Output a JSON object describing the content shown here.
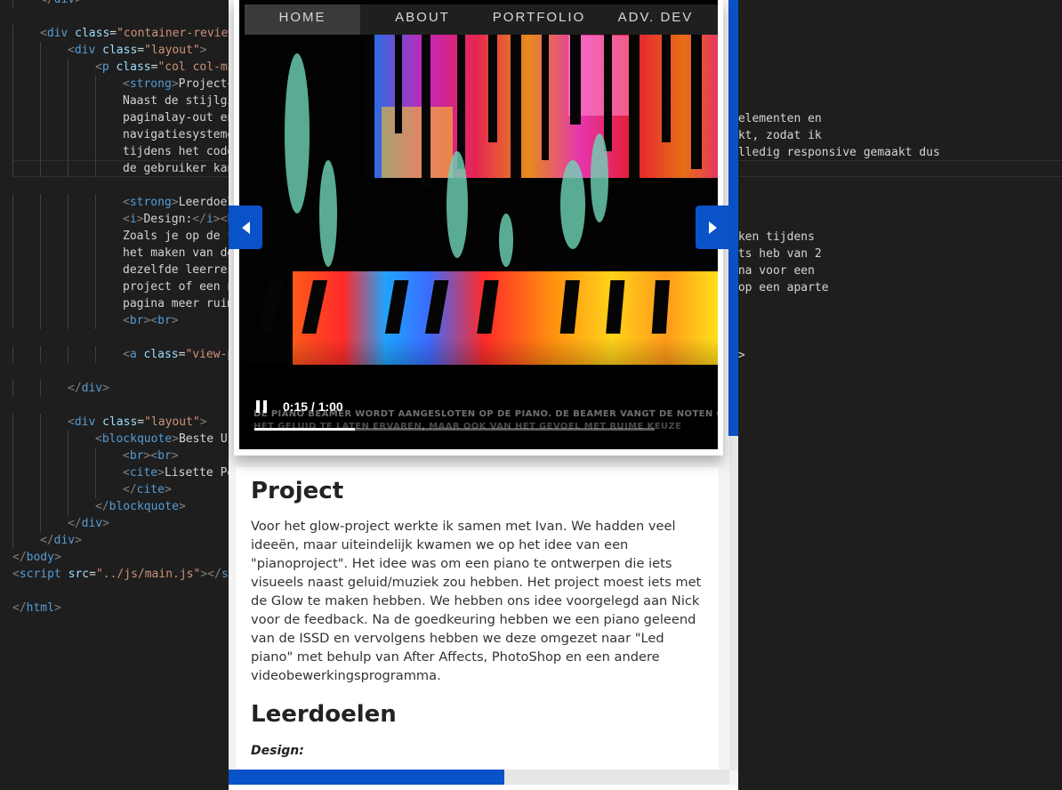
{
  "editor": {
    "lines": [
      {
        "indent": 1,
        "html": [
          {
            "t": "br",
            "v": "</"
          },
          {
            "t": "tag",
            "v": "div"
          },
          {
            "t": "br",
            "v": ">"
          }
        ]
      },
      {
        "indent": 0,
        "html": []
      },
      {
        "indent": 1,
        "html": [
          {
            "t": "br",
            "v": "<"
          },
          {
            "t": "tag",
            "v": "div"
          },
          {
            "t": "txt",
            "v": " "
          },
          {
            "t": "attr",
            "v": "class"
          },
          {
            "t": "txt",
            "v": "="
          },
          {
            "t": "str",
            "v": "\"container-review"
          }
        ]
      },
      {
        "indent": 2,
        "html": [
          {
            "t": "br",
            "v": "<"
          },
          {
            "t": "tag",
            "v": "div"
          },
          {
            "t": "txt",
            "v": " "
          },
          {
            "t": "attr",
            "v": "class"
          },
          {
            "t": "txt",
            "v": "="
          },
          {
            "t": "str",
            "v": "\"layout\""
          },
          {
            "t": "br",
            "v": ">"
          }
        ]
      },
      {
        "indent": 3,
        "html": [
          {
            "t": "br",
            "v": "<"
          },
          {
            "t": "tag",
            "v": "p"
          },
          {
            "t": "txt",
            "v": " "
          },
          {
            "t": "attr",
            "v": "class"
          },
          {
            "t": "txt",
            "v": "="
          },
          {
            "t": "str",
            "v": "\"col col-ma"
          }
        ]
      },
      {
        "indent": 4,
        "html": [
          {
            "t": "br",
            "v": "<"
          },
          {
            "t": "tag",
            "v": "strong"
          },
          {
            "t": "br",
            "v": ">"
          },
          {
            "t": "txt",
            "v": "Project"
          },
          {
            "t": "br",
            "v": "<"
          }
        ]
      },
      {
        "indent": 4,
        "html": [
          {
            "t": "txt",
            "v": "Naast de stijlgi"
          }
        ]
      },
      {
        "indent": 4,
        "html": [
          {
            "t": "txt",
            "v": "paginalay-out en"
          }
        ]
      },
      {
        "indent": 4,
        "html": [
          {
            "t": "txt",
            "v": "navigatiesysteme"
          }
        ]
      },
      {
        "indent": 4,
        "html": [
          {
            "t": "txt",
            "v": "tijdens het code"
          }
        ]
      },
      {
        "indent": 4,
        "html": [
          {
            "t": "txt",
            "v": "de gebruiker kan"
          }
        ],
        "hl": true
      },
      {
        "indent": 0,
        "html": []
      },
      {
        "indent": 4,
        "html": [
          {
            "t": "br",
            "v": "<"
          },
          {
            "t": "tag",
            "v": "strong"
          },
          {
            "t": "br",
            "v": ">"
          },
          {
            "t": "txt",
            "v": "Leerdoel"
          }
        ]
      },
      {
        "indent": 4,
        "html": [
          {
            "t": "br",
            "v": "<"
          },
          {
            "t": "tag",
            "v": "i"
          },
          {
            "t": "br",
            "v": ">"
          },
          {
            "t": "txt",
            "v": "Design:"
          },
          {
            "t": "br",
            "v": "</"
          },
          {
            "t": "tag",
            "v": "i"
          },
          {
            "t": "br",
            "v": "><"
          },
          {
            "t": "tag",
            "v": "b"
          }
        ]
      },
      {
        "indent": 4,
        "html": [
          {
            "t": "txt",
            "v": "Zoals je op de f"
          }
        ]
      },
      {
        "indent": 4,
        "html": [
          {
            "t": "txt",
            "v": "het maken van de"
          }
        ]
      },
      {
        "indent": 4,
        "html": [
          {
            "t": "txt",
            "v": "dezelfde leerres"
          }
        ]
      },
      {
        "indent": 4,
        "html": [
          {
            "t": "txt",
            "v": "project of een n"
          }
        ]
      },
      {
        "indent": 4,
        "html": [
          {
            "t": "txt",
            "v": "pagina meer ruim"
          }
        ]
      },
      {
        "indent": 4,
        "html": [
          {
            "t": "br",
            "v": "<"
          },
          {
            "t": "tag",
            "v": "br"
          },
          {
            "t": "br",
            "v": "><"
          },
          {
            "t": "tag",
            "v": "br"
          },
          {
            "t": "br",
            "v": ">"
          }
        ]
      },
      {
        "indent": 0,
        "html": []
      },
      {
        "indent": 4,
        "html": [
          {
            "t": "br",
            "v": "<"
          },
          {
            "t": "tag",
            "v": "a"
          },
          {
            "t": "txt",
            "v": " "
          },
          {
            "t": "attr",
            "v": "class"
          },
          {
            "t": "txt",
            "v": "="
          },
          {
            "t": "str",
            "v": "\"view-p"
          }
        ]
      },
      {
        "indent": 0,
        "html": []
      },
      {
        "indent": 2,
        "html": [
          {
            "t": "br",
            "v": "</"
          },
          {
            "t": "tag",
            "v": "div"
          },
          {
            "t": "br",
            "v": ">"
          }
        ]
      },
      {
        "indent": 0,
        "html": []
      },
      {
        "indent": 2,
        "html": [
          {
            "t": "br",
            "v": "<"
          },
          {
            "t": "tag",
            "v": "div"
          },
          {
            "t": "txt",
            "v": " "
          },
          {
            "t": "attr",
            "v": "class"
          },
          {
            "t": "txt",
            "v": "="
          },
          {
            "t": "str",
            "v": "\"layout\""
          },
          {
            "t": "br",
            "v": ">"
          }
        ]
      },
      {
        "indent": 3,
        "html": [
          {
            "t": "br",
            "v": "<"
          },
          {
            "t": "tag",
            "v": "blockquote"
          },
          {
            "t": "br",
            "v": ">"
          },
          {
            "t": "txt",
            "v": "Beste Ur"
          }
        ]
      },
      {
        "indent": 4,
        "html": [
          {
            "t": "br",
            "v": "<"
          },
          {
            "t": "tag",
            "v": "br"
          },
          {
            "t": "br",
            "v": "><"
          },
          {
            "t": "tag",
            "v": "br"
          },
          {
            "t": "br",
            "v": ">"
          }
        ]
      },
      {
        "indent": 4,
        "html": [
          {
            "t": "br",
            "v": "<"
          },
          {
            "t": "tag",
            "v": "cite"
          },
          {
            "t": "br",
            "v": ">"
          },
          {
            "t": "txt",
            "v": "Lisette Pe"
          }
        ]
      },
      {
        "indent": 4,
        "html": [
          {
            "t": "br",
            "v": "</"
          },
          {
            "t": "tag",
            "v": "cite"
          },
          {
            "t": "br",
            "v": ">"
          }
        ]
      },
      {
        "indent": 3,
        "html": [
          {
            "t": "br",
            "v": "</"
          },
          {
            "t": "tag",
            "v": "blockquote"
          },
          {
            "t": "br",
            "v": ">"
          }
        ]
      },
      {
        "indent": 2,
        "html": [
          {
            "t": "br",
            "v": "</"
          },
          {
            "t": "tag",
            "v": "div"
          },
          {
            "t": "br",
            "v": ">"
          }
        ]
      },
      {
        "indent": 1,
        "html": [
          {
            "t": "br",
            "v": "</"
          },
          {
            "t": "tag",
            "v": "div"
          },
          {
            "t": "br",
            "v": ">"
          }
        ]
      },
      {
        "indent": 0,
        "html": [
          {
            "t": "br",
            "v": "</"
          },
          {
            "t": "tag",
            "v": "body"
          },
          {
            "t": "br",
            "v": ">"
          }
        ]
      },
      {
        "indent": 0,
        "html": [
          {
            "t": "br",
            "v": "<"
          },
          {
            "t": "tag",
            "v": "script"
          },
          {
            "t": "txt",
            "v": " "
          },
          {
            "t": "attr",
            "v": "src"
          },
          {
            "t": "txt",
            "v": "="
          },
          {
            "t": "str",
            "v": "\"../js/main.js\""
          },
          {
            "t": "br",
            "v": "></"
          },
          {
            "t": "tag",
            "v": "sc"
          }
        ]
      },
      {
        "indent": 0,
        "html": []
      },
      {
        "indent": 0,
        "html": [
          {
            "t": "br",
            "v": "</"
          },
          {
            "t": "tag",
            "v": "html"
          },
          {
            "t": "br",
            "v": ">"
          }
        ]
      }
    ],
    "right_fragments": [
      {
        "line": 6,
        "text": "e"
      },
      {
        "line": 7,
        "text": "-elementen en"
      },
      {
        "line": 8,
        "text": "akt, zodat ik"
      },
      {
        "line": 9,
        "text": "olledig responsive gemaakt dus"
      },
      {
        "line": 14,
        "text": "aken tijdens"
      },
      {
        "line": 15,
        "text": "ots heb van 2"
      },
      {
        "line": 16,
        "text": "ina voor een"
      },
      {
        "line": 17,
        "text": " op een aparte"
      },
      {
        "line": 21,
        "text": "a>"
      }
    ]
  },
  "nav": {
    "items": [
      "HOME",
      "ABOUT",
      "PORTFOLIO",
      "ADV. DEV"
    ],
    "active": "HOME"
  },
  "video": {
    "time": "0:15 / 1:00",
    "caption": "DE PIANO BEAMER WORDT AANGESLOTEN OP DE PIANO. DE BEAMER VANGT DE NOTEN OP EN PROJECTEERT",
    "caption_line2": "HET GELUID TE LATEN ERVAREN, MAAR OOK VAN HET GEVOEL MET RUIME KEUZE",
    "progress_fraction": 0.25
  },
  "content": {
    "project_title": "Project",
    "project_text": "Voor het glow-project werkte ik samen met Ivan. We hadden veel ideeën, maar uiteindelijk kwamen we op het idee van een \"pianoproject\". Het idee was om een piano te ontwerpen die iets visueels naast geluid/muziek zou hebben. Het project moest iets met de Glow te maken hebben. We hebben ons idee voorgelegd aan Nick voor de feedback. Na de goedkeuring hebben we een piano geleend van de ISSD en vervolgens hebben we deze omgezet naar \"Led piano\" met behulp van After Affects, PhotoShop en een andere videobewerkingsprogramma.",
    "leerdoelen_title": "Leerdoelen",
    "design_label": "Design:"
  },
  "page_progress_fraction": 0.55,
  "colors": {
    "accent": "#0a52c7",
    "editor_bg": "#1e1e1e"
  },
  "icons": {
    "prev": "chevron-left-icon",
    "next": "chevron-right-icon",
    "pause": "pause-icon"
  }
}
